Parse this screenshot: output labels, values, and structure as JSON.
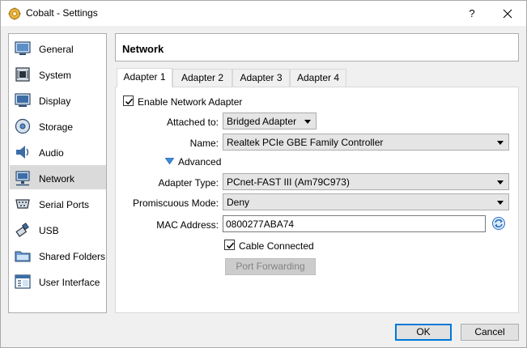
{
  "window": {
    "title": "Cobalt - Settings",
    "help_label": "?"
  },
  "sidebar": {
    "items": [
      {
        "label": "General",
        "icon": "general-icon"
      },
      {
        "label": "System",
        "icon": "system-icon"
      },
      {
        "label": "Display",
        "icon": "display-icon"
      },
      {
        "label": "Storage",
        "icon": "storage-icon"
      },
      {
        "label": "Audio",
        "icon": "audio-icon"
      },
      {
        "label": "Network",
        "icon": "network-icon",
        "selected": true
      },
      {
        "label": "Serial Ports",
        "icon": "serial-ports-icon"
      },
      {
        "label": "USB",
        "icon": "usb-icon"
      },
      {
        "label": "Shared Folders",
        "icon": "shared-folders-icon"
      },
      {
        "label": "User Interface",
        "icon": "user-interface-icon"
      }
    ]
  },
  "header": {
    "title": "Network"
  },
  "tabs": [
    {
      "label": "Adapter 1",
      "selected": true
    },
    {
      "label": "Adapter 2"
    },
    {
      "label": "Adapter 3"
    },
    {
      "label": "Adapter 4"
    }
  ],
  "adapter": {
    "enable_label": "Enable Network Adapter",
    "enabled": true,
    "attached_label": "Attached to:",
    "attached_value": "Bridged Adapter",
    "name_label": "Name:",
    "name_value": "Realtek PCIe GBE Family Controller",
    "advanced_label": "Advanced",
    "adapter_type_label": "Adapter Type:",
    "adapter_type_value": "PCnet-FAST III (Am79C973)",
    "promiscuous_label": "Promiscuous Mode:",
    "promiscuous_value": "Deny",
    "mac_label": "MAC Address:",
    "mac_value": "0800277ABA74",
    "cable_label": "Cable Connected",
    "cable_connected": true,
    "port_forwarding_label": "Port Forwarding"
  },
  "footer": {
    "ok_label": "OK",
    "cancel_label": "Cancel"
  },
  "colors": {
    "accent": "#0078d7",
    "selected_bg": "#dadada",
    "disabled_text": "#838383"
  }
}
